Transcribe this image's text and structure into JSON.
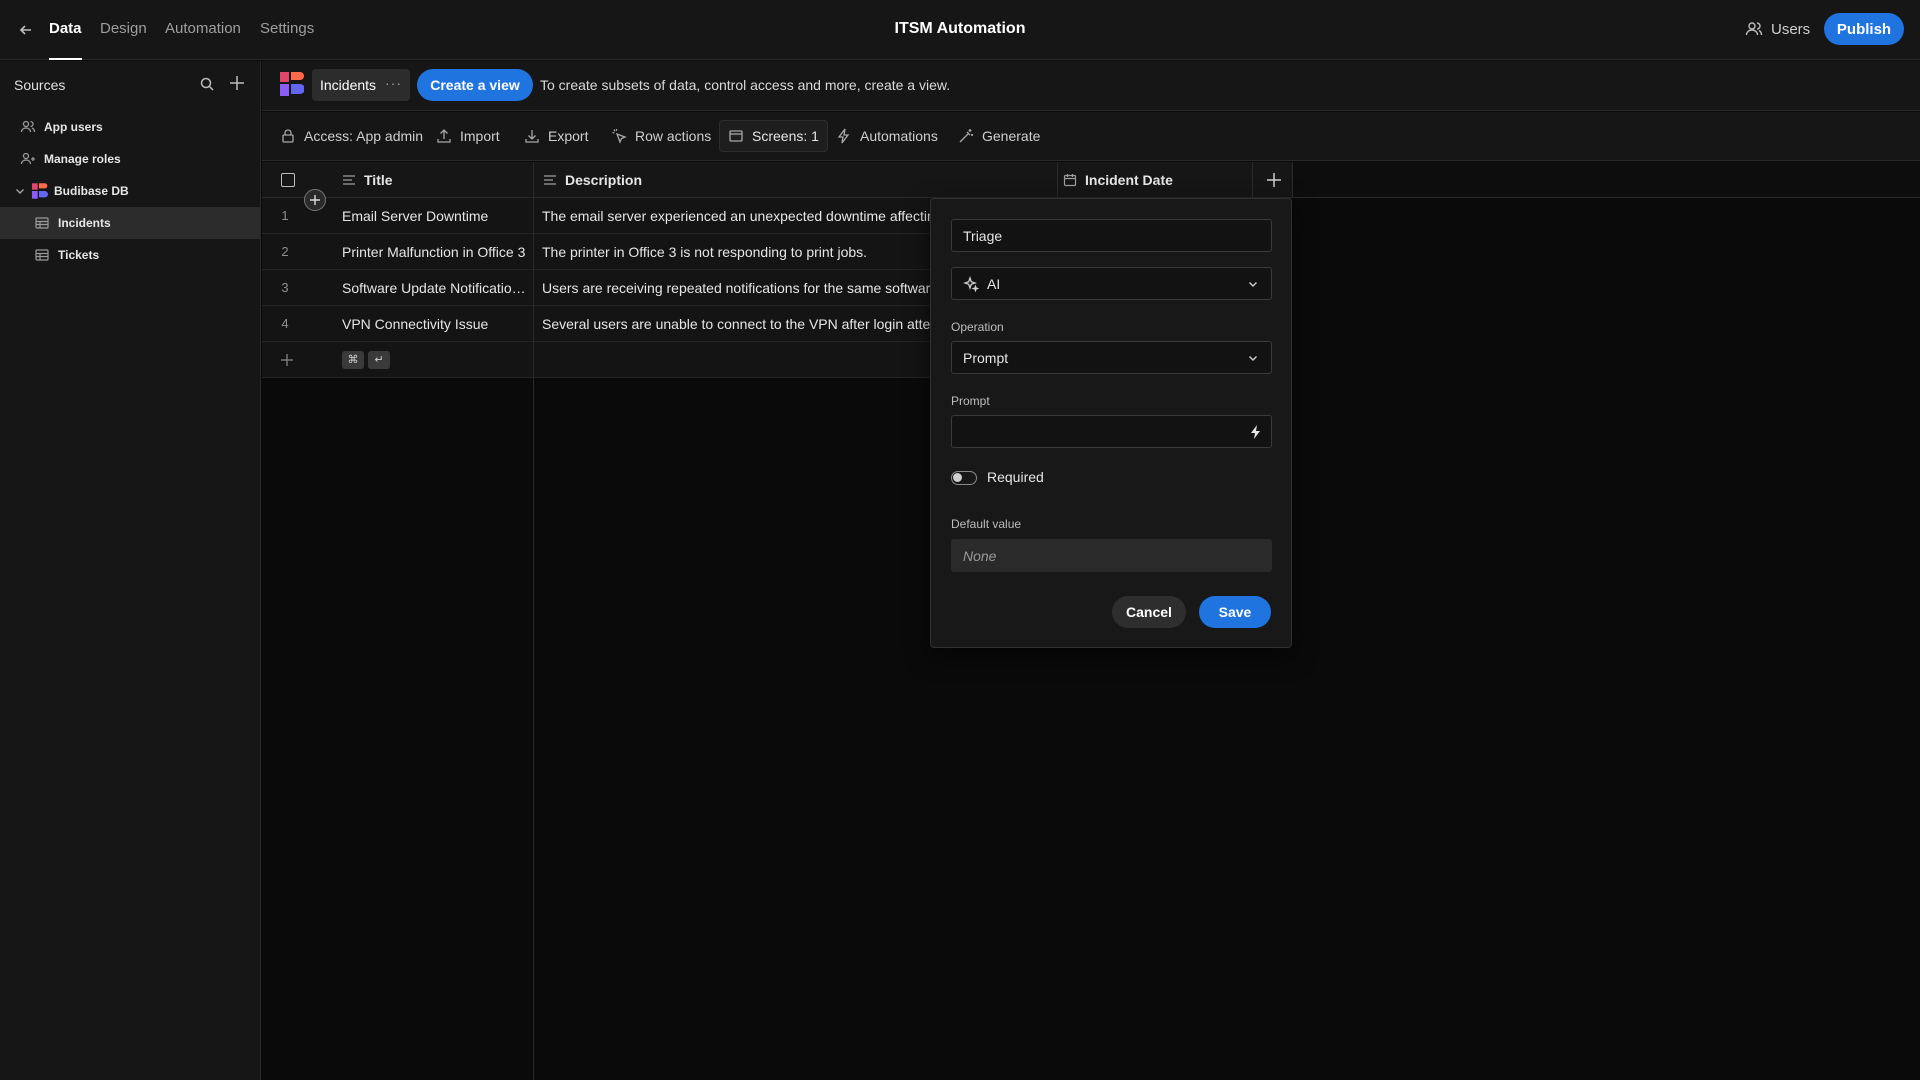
{
  "nav": {
    "tabs": [
      {
        "label": "Data",
        "active": true
      },
      {
        "label": "Design",
        "active": false
      },
      {
        "label": "Automation",
        "active": false
      },
      {
        "label": "Settings",
        "active": false
      }
    ],
    "app_title": "ITSM Automation",
    "users_label": "Users",
    "publish_label": "Publish"
  },
  "sidebar": {
    "title": "Sources",
    "items": [
      {
        "label": "App users",
        "icon": "users-icon"
      },
      {
        "label": "Manage roles",
        "icon": "user-roles-icon"
      },
      {
        "label": "Budibase DB",
        "icon": "budibase-logo",
        "expanded": true
      },
      {
        "label": "Incidents",
        "icon": "table-icon",
        "selected": true
      },
      {
        "label": "Tickets",
        "icon": "table-icon"
      }
    ]
  },
  "table_bar": {
    "table_name": "Incidents",
    "more": "···",
    "create_view_label": "Create a view",
    "hint": "To create subsets of data, control access and more, create a view."
  },
  "actions": {
    "access": "Access: App admin",
    "import": "Import",
    "export": "Export",
    "row_actions": "Row actions",
    "screens": "Screens: 1",
    "automations": "Automations",
    "generate": "Generate"
  },
  "grid": {
    "columns": [
      "Title",
      "Description",
      "Incident Date"
    ],
    "rows": [
      {
        "num": "1",
        "title": "Email Server Downtime",
        "description": "The email server experienced an unexpected downtime affecting al"
      },
      {
        "num": "2",
        "title": "Printer Malfunction in Office 3",
        "description": "The printer in Office 3 is not responding to print jobs."
      },
      {
        "num": "3",
        "title": "Software Update Notification Issue",
        "description": "Users are receiving repeated notifications for the same software up"
      },
      {
        "num": "4",
        "title": "VPN Connectivity Issue",
        "description": "Several users are unable to connect to the VPN after login attempts"
      }
    ],
    "kbd_keys": [
      "⌘",
      "↵"
    ]
  },
  "popover": {
    "column_name": "Triage",
    "type_value": "AI",
    "operation_label": "Operation",
    "operation_value": "Prompt",
    "prompt_label": "Prompt",
    "prompt_value": "",
    "required_label": "Required",
    "required_on": false,
    "default_label": "Default value",
    "default_placeholder": "None",
    "cancel_label": "Cancel",
    "save_label": "Save"
  },
  "colors": {
    "accent": "#1f74e0",
    "background": "#0a0a0a",
    "panel": "#161616"
  }
}
